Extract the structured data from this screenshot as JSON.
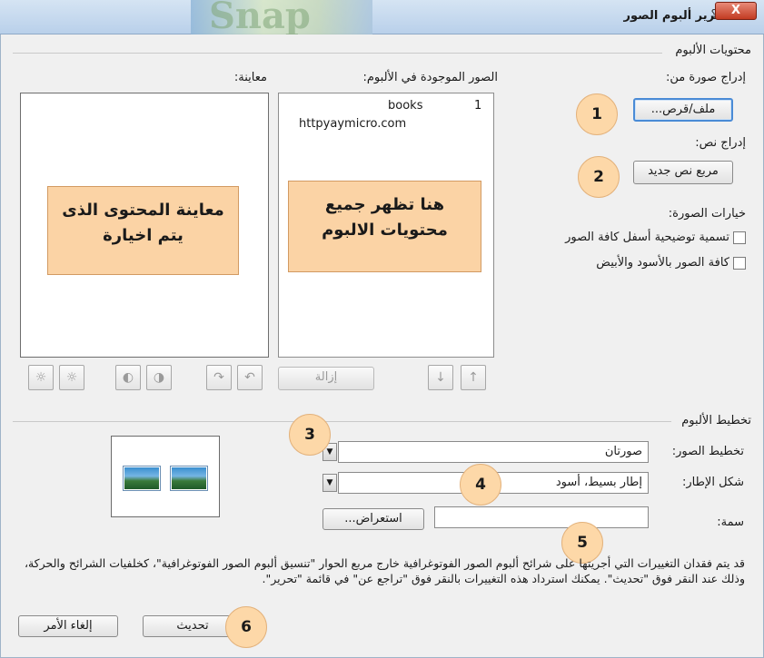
{
  "window": {
    "title": "تحرير ألبوم الصور",
    "help_glyph": "؟",
    "close_glyph": "X",
    "background_art_text": "Snap"
  },
  "album_contents": {
    "group_label": "محتويات الألبوم",
    "insert_picture_label": "إدراج صورة من:",
    "file_disk_button": "ملف/قرص...",
    "insert_text_label": "إدراج نص:",
    "new_text_box_button": "مربع نص جديد",
    "picture_options_label": "خيارات الصورة:",
    "captions_checkbox": "تسمية توضيحية أسفل كافة الصور",
    "black_white_checkbox": "كافة الصور بالأسود والأبيض",
    "pictures_in_album_label": "الصور الموجودة في الألبوم:",
    "preview_label": "معاينة:",
    "album_items": [
      {
        "index": "1",
        "name": "books"
      },
      {
        "index": "",
        "name": "httpyaymicro.com"
      }
    ],
    "remove_button": "إزالة",
    "move_up_glyph": "↑",
    "move_down_glyph": "↓",
    "callout_list": "هنا تظهر جميع محتويات الالبوم",
    "callout_preview": "معاينة المحتوى الذى يتم اخيارة",
    "image_tool_icons": [
      "rotate-left-icon",
      "rotate-right-icon",
      "contrast-up-icon",
      "contrast-down-icon",
      "brightness-up-icon",
      "brightness-down-icon"
    ]
  },
  "album_layout": {
    "group_label": "تخطيط الألبوم",
    "picture_layout_label": "تخطيط الصور:",
    "picture_layout_value": "صورتان",
    "frame_shape_label": "شكل الإطار:",
    "frame_shape_value": "إطار بسيط، أسود",
    "theme_label": "سمة:",
    "theme_value": "",
    "browse_button": "استعراض...",
    "dropdown_glyph": "▼"
  },
  "notice_text": "قد يتم فقدان التغييرات التي أجريتها على شرائح ألبوم الصور الفوتوغرافية خارج مربع الحوار \"تنسيق ألبوم الصور الفوتوغرافية\"، كخلفيات الشرائح والحركة، وذلك عند النقر فوق \"تحديث\". يمكنك استرداد هذه التغييرات بالنقر فوق \"تراجع عن\" في قائمة \"تحرير\".",
  "footer": {
    "update_button": "تحديث",
    "cancel_button": "إلغاء الأمر"
  },
  "step_numbers": [
    "1",
    "2",
    "3",
    "4",
    "5",
    "6"
  ],
  "colors": {
    "callout_fill": "#fbd3a5",
    "step_circle_fill": "#fdd8a8",
    "close_button": "#c23b22"
  }
}
